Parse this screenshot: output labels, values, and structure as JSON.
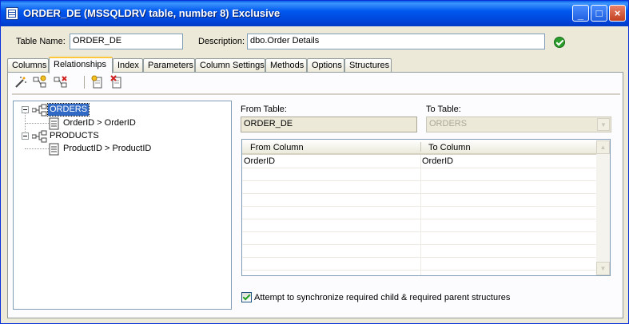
{
  "window": {
    "title": "ORDER_DE  (MSSQLDRV table, number 8)  Exclusive",
    "controls": {
      "minimize": "_",
      "maximize": "□",
      "close": "×"
    }
  },
  "header": {
    "table_name_label": "Table Name:",
    "table_name_value": "ORDER_DE",
    "description_label": "Description:",
    "description_value": "dbo.Order Details"
  },
  "tabs": [
    {
      "label": "Columns",
      "active": false
    },
    {
      "label": "Relationships",
      "active": true
    },
    {
      "label": "Index",
      "active": false
    },
    {
      "label": "Parameters",
      "active": false
    },
    {
      "label": "Column Settings",
      "active": false
    },
    {
      "label": "Methods",
      "active": false
    },
    {
      "label": "Options",
      "active": false
    },
    {
      "label": "Structures",
      "active": false
    }
  ],
  "toolbar": {
    "icons": [
      "wand-icon",
      "add-relation-icon",
      "delete-relation-icon",
      "new-document-icon",
      "delete-document-icon"
    ]
  },
  "tree": {
    "nodes": [
      {
        "label": "ORDERS",
        "selected": true,
        "children": [
          {
            "label": "OrderID > OrderID"
          }
        ]
      },
      {
        "label": "PRODUCTS",
        "selected": false,
        "children": [
          {
            "label": "ProductID > ProductID"
          }
        ]
      }
    ]
  },
  "relationship": {
    "from_table_label": "From Table:",
    "from_table_value": "ORDER_DE",
    "to_table_label": "To Table:",
    "to_table_value": "ORDERS",
    "grid": {
      "columns": [
        "From Column",
        "To Column"
      ],
      "rows": [
        [
          "OrderID",
          "OrderID"
        ]
      ]
    },
    "sync_checkbox": {
      "label": "Attempt to synchronize required child & required parent structures",
      "checked": true
    }
  },
  "colors": {
    "title_bar": "#0058ee",
    "selection": "#316ac5",
    "ok": "#2a9d2a",
    "tab_highlight": "#ffc83c"
  }
}
